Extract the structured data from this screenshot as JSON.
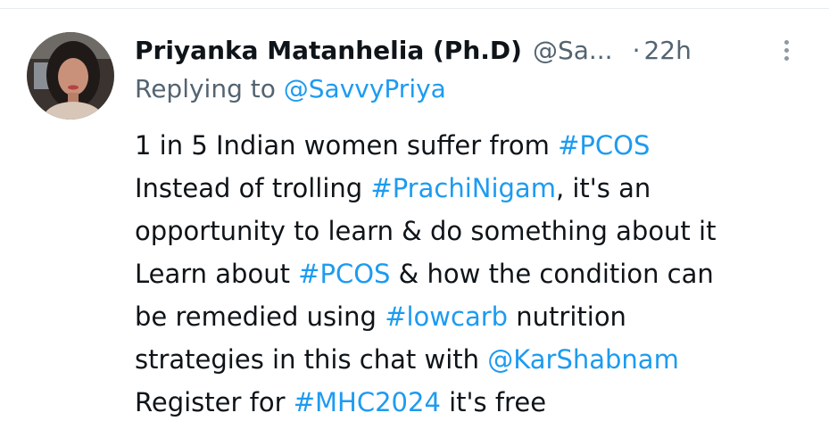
{
  "tweet": {
    "author_name": "Priyanka Matanhelia (Ph.D)",
    "author_handle": "@Sa...",
    "separator": "·",
    "time": "22h",
    "replying_prefix": "Replying to",
    "replying_to": "@SavvyPriya",
    "lines": [
      [
        {
          "text": "1 in 5 Indian women suffer from "
        },
        {
          "text": "#PCOS",
          "link": true
        }
      ],
      [
        {
          "text": "Instead of trolling "
        },
        {
          "text": "#PrachiNigam",
          "link": true
        },
        {
          "text": ", it's an"
        }
      ],
      [
        {
          "text": "opportunity to learn & do something about it"
        }
      ],
      [
        {
          "text": "Learn about "
        },
        {
          "text": "#PCOS",
          "link": true
        },
        {
          "text": " & how the condition can"
        }
      ],
      [
        {
          "text": "be remedied using "
        },
        {
          "text": "#lowcarb",
          "link": true
        },
        {
          "text": " nutrition"
        }
      ],
      [
        {
          "text": "strategies in this chat with "
        },
        {
          "text": "@KarShabnam",
          "link": true
        }
      ],
      [
        {
          "text": "Register for "
        },
        {
          "text": "#MHC2024",
          "link": true
        },
        {
          "text": " it's free"
        }
      ]
    ]
  },
  "icons": {
    "avatar": "avatar-photo",
    "more": "more-dots-icon"
  },
  "colors": {
    "link": "#1d9bf0",
    "secondary": "#536471",
    "text": "#0f1419"
  }
}
